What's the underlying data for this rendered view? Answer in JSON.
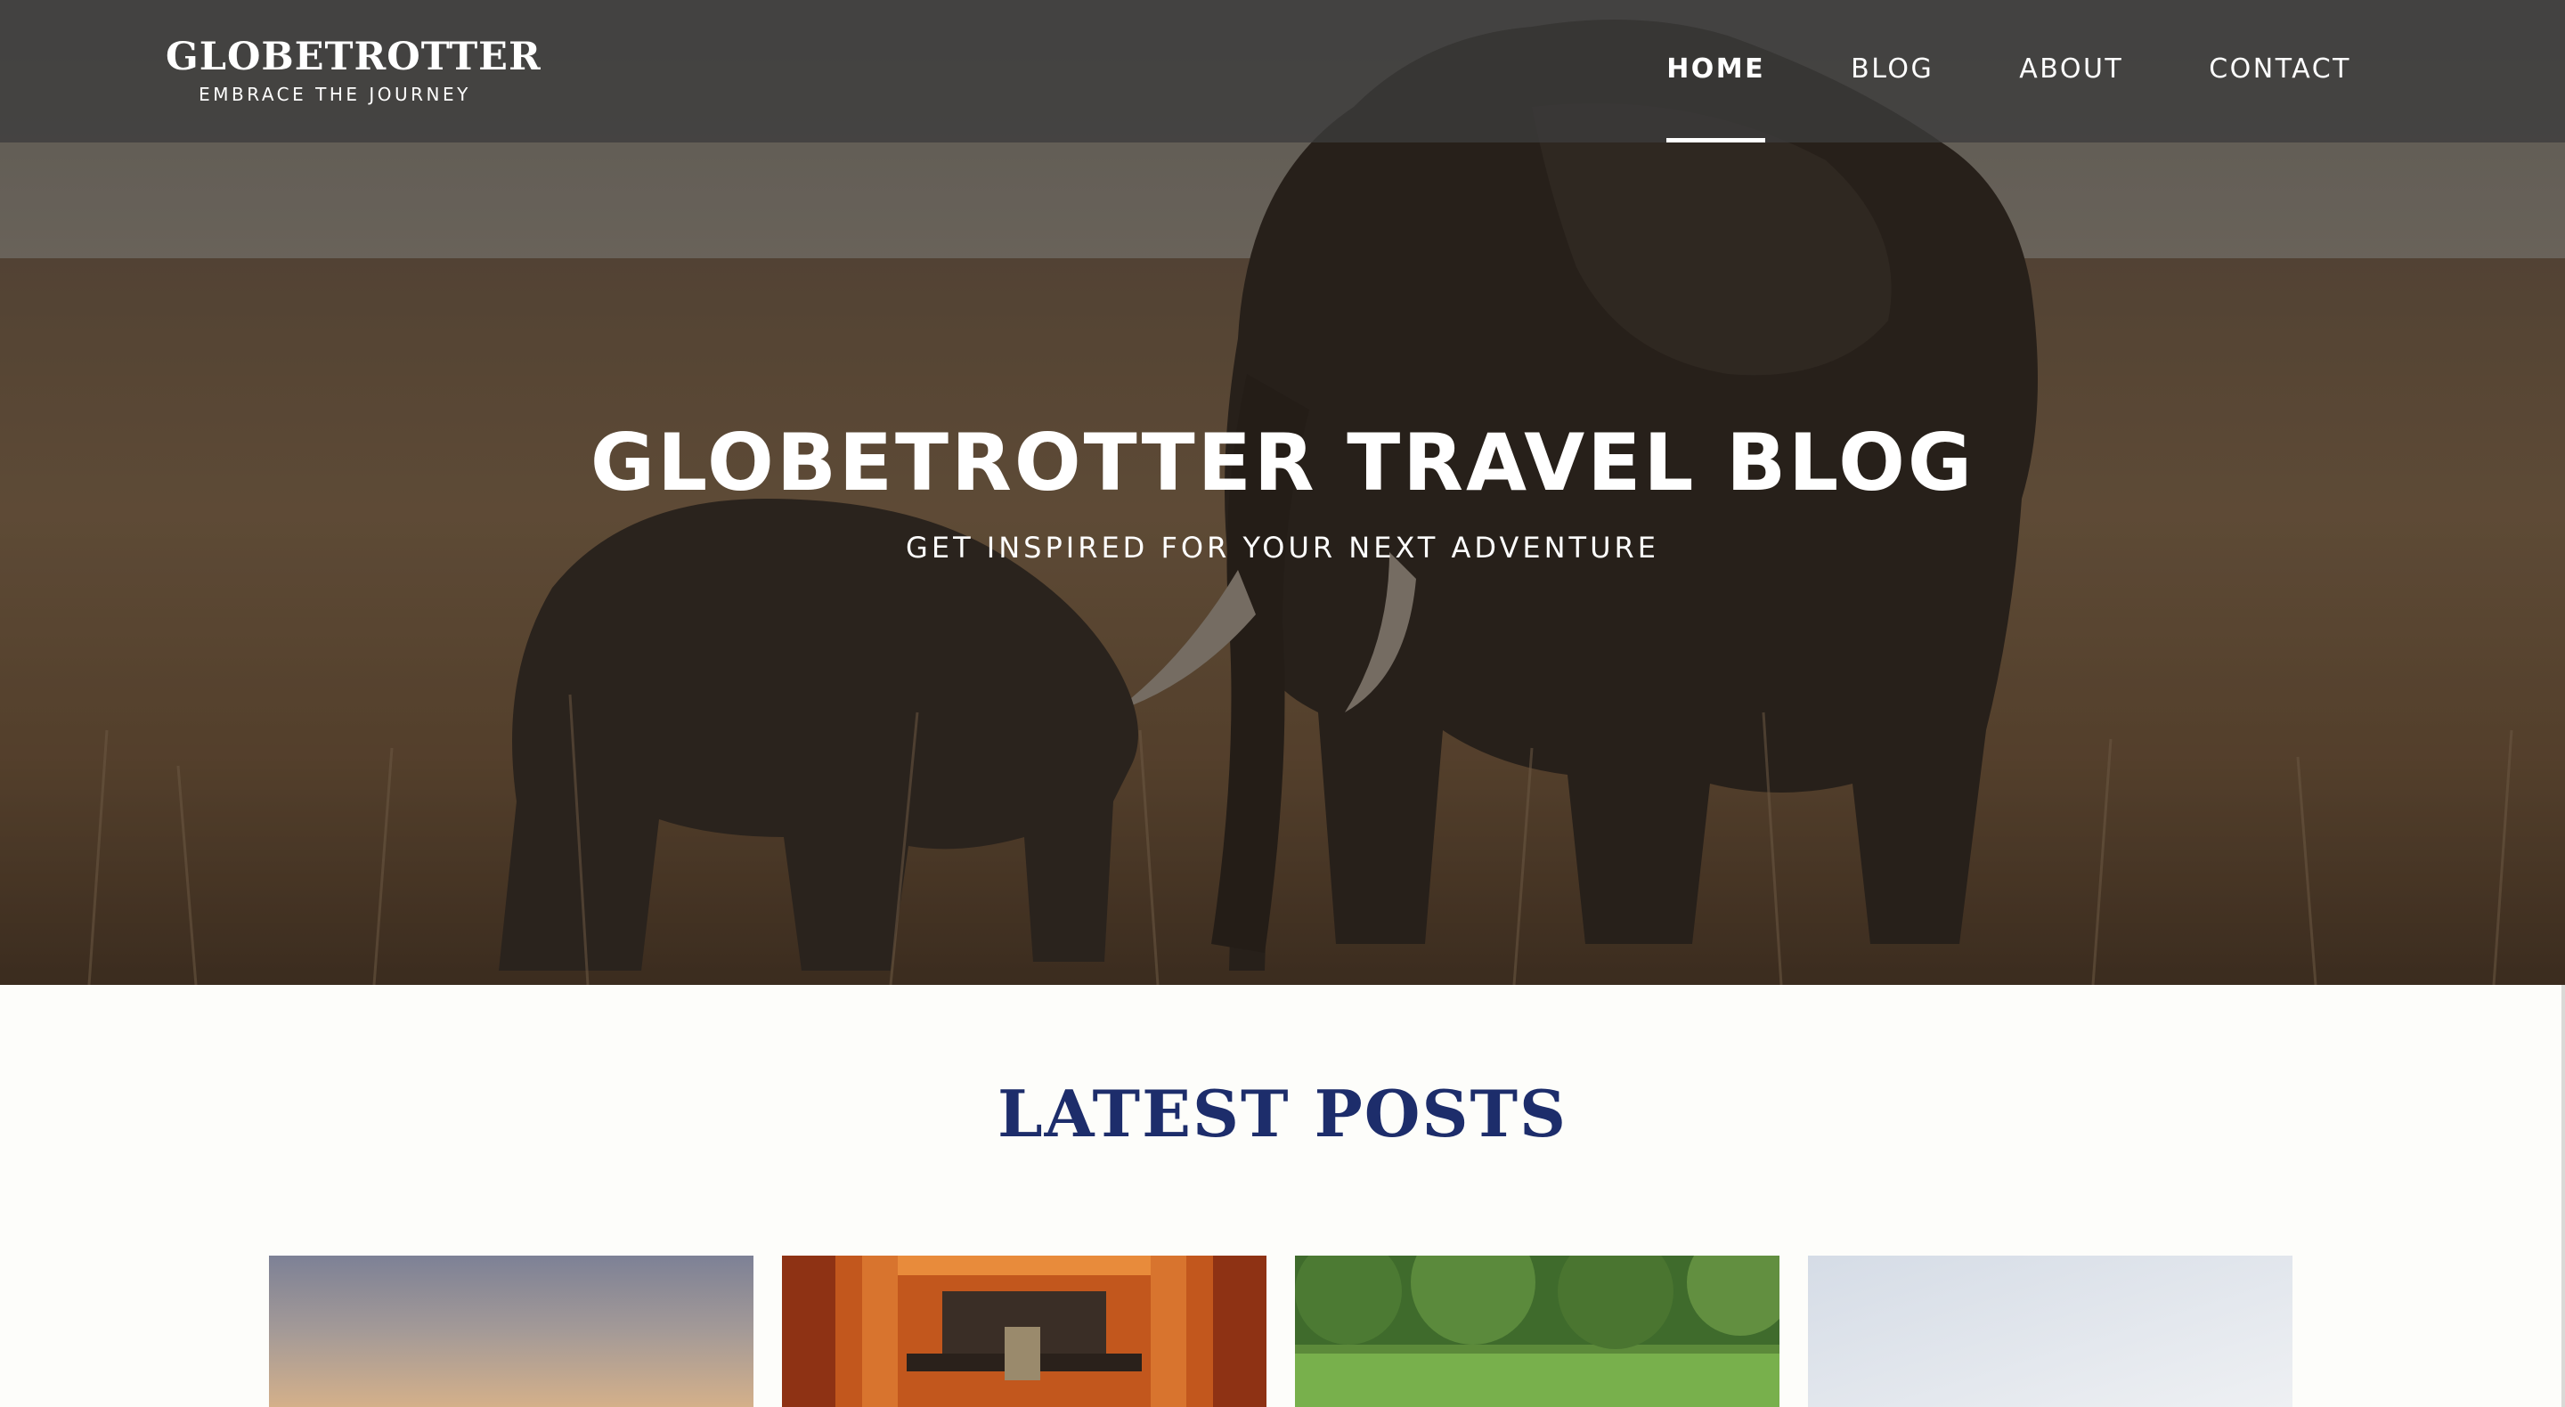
{
  "brand": {
    "name": "GLOBETROTTER",
    "tagline": "EMBRACE THE JOURNEY"
  },
  "nav": {
    "items": [
      {
        "label": "HOME",
        "active": true
      },
      {
        "label": "BLOG",
        "active": false
      },
      {
        "label": "ABOUT",
        "active": false
      },
      {
        "label": "CONTACT",
        "active": false
      }
    ]
  },
  "hero": {
    "title": "GLOBETROTTER TRAVEL BLOG",
    "subtitle": "GET INSPIRED FOR YOUR NEXT ADVENTURE",
    "image": "elephants-savanna-photo"
  },
  "latest_posts": {
    "heading": "LATEST POSTS",
    "cards": [
      {
        "image": "sunset-sky-photo"
      },
      {
        "image": "torii-gates-photo"
      },
      {
        "image": "green-forest-photo"
      },
      {
        "image": "pale-sky-photo"
      }
    ]
  },
  "colors": {
    "heading": "#1d2d6b",
    "nav_bg": "#3c3c3c",
    "text_light": "#ffffff",
    "page_bg": "#fdfdfa"
  }
}
